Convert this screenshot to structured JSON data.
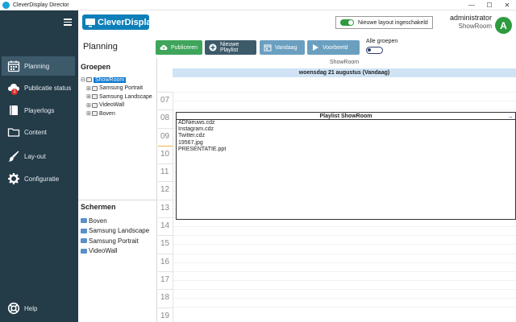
{
  "window": {
    "title": "CleverDisplay Director",
    "minimize": "—",
    "maximize": "☐",
    "close": "✕"
  },
  "sidebar": {
    "items": [
      {
        "label": "Planning",
        "icon": "calendar-icon"
      },
      {
        "label": "Publicatie status",
        "icon": "cloud-icon",
        "badge": "1"
      },
      {
        "label": "Playerlogs",
        "icon": "book-icon"
      },
      {
        "label": "Content",
        "icon": "folder-icon"
      },
      {
        "label": "Lay-out",
        "icon": "brush-icon"
      },
      {
        "label": "Configuratie",
        "icon": "gear-icon"
      }
    ],
    "help": "Help"
  },
  "header": {
    "logo": "CleverDisplay",
    "toggle_label": "Nieuwe layout ingeschakeld",
    "user_name": "administrator",
    "user_location": "ShowRoom",
    "avatar": "A",
    "accent": "#2e9b3e"
  },
  "toolbar": {
    "title": "Planning",
    "buttons": [
      {
        "label": "Publiceren",
        "icon": "cloud-upload-icon"
      },
      {
        "label": "Nieuwe Playlist",
        "icon": "plus-circle-icon"
      },
      {
        "label": "Vandaag",
        "icon": "calendar-day-icon"
      },
      {
        "label": "Voorbeeld",
        "icon": "play-icon"
      }
    ],
    "alle_groepen": "Alle groepen"
  },
  "groepen": {
    "heading": "Groepen",
    "tree": [
      {
        "label": "ShowRoom",
        "selected": true,
        "expander": "⊟"
      },
      {
        "label": "Samsung Portrait",
        "expander": "⊞"
      },
      {
        "label": "Samsung Landscape",
        "expander": "⊞"
      },
      {
        "label": "VideoWall",
        "expander": "⊞"
      },
      {
        "label": "Boven",
        "expander": "⊞"
      }
    ]
  },
  "schermen": {
    "heading": "Schermen",
    "items": [
      "Boven",
      "Samsung Landscape",
      "Samsung Portrait",
      "VideoWall"
    ]
  },
  "calendar": {
    "group": "ShowRoom",
    "date": "woensdag 21 augustus (Vandaag)",
    "hours": [
      "07",
      "08",
      "09",
      "10",
      "11",
      "12",
      "13",
      "14",
      "15",
      "16",
      "17",
      "18",
      "19"
    ],
    "event": {
      "title": "Playlist ShowRoom",
      "items": [
        "ADNieuws.cdz",
        "Instagram.cdz",
        "Twitter.cdz",
        "19567.jpg",
        "PRESENTATIE.ppt"
      ],
      "arrow": "→"
    }
  }
}
